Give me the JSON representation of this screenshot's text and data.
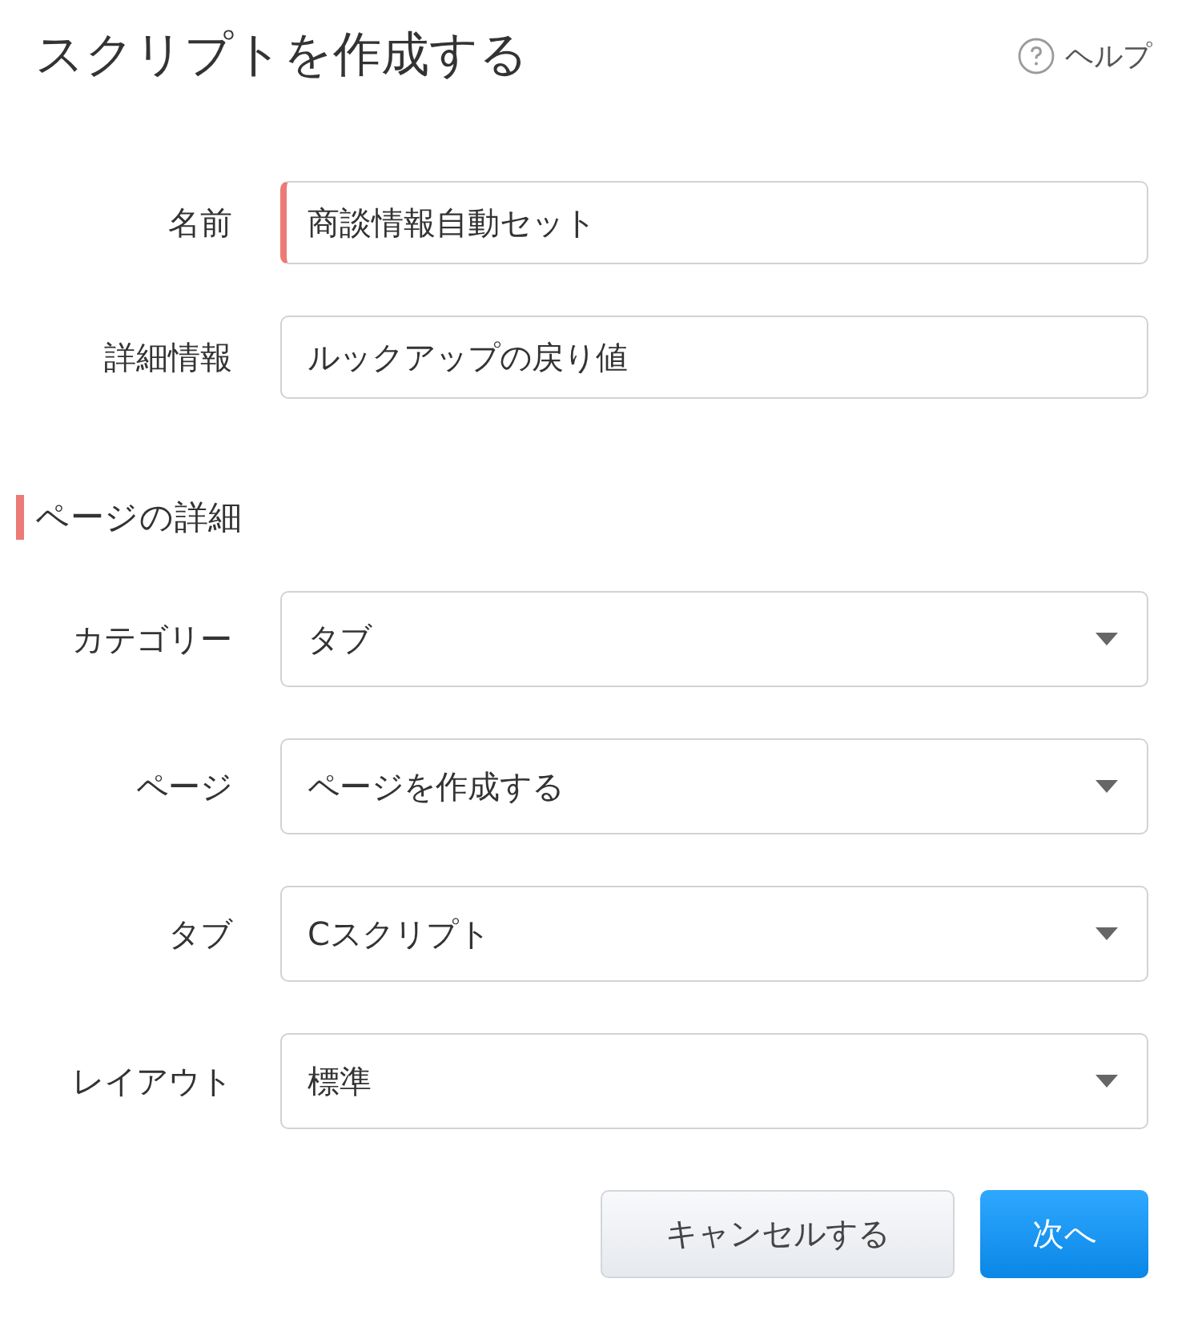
{
  "title": "スクリプトを作成する",
  "help": {
    "label": "ヘルプ"
  },
  "fields": [
    {
      "label": "名前",
      "kind": "text",
      "value": "商談情報自動セット",
      "required": true
    },
    {
      "label": "詳細情報",
      "kind": "text",
      "value": "ルックアップの戻り値",
      "required": false
    }
  ],
  "section": {
    "heading": "ページの詳細",
    "fields": [
      {
        "label": "カテゴリー",
        "kind": "select",
        "value": "タブ"
      },
      {
        "label": "ページ",
        "kind": "select",
        "value": "ページを作成する"
      },
      {
        "label": "タブ",
        "kind": "select",
        "value": "Cスクリプト"
      },
      {
        "label": "レイアウト",
        "kind": "select",
        "value": "標準"
      }
    ]
  },
  "buttons": [
    {
      "label": "キャンセルする",
      "kind": "secondary"
    },
    {
      "label": "次へ",
      "kind": "primary"
    }
  ]
}
